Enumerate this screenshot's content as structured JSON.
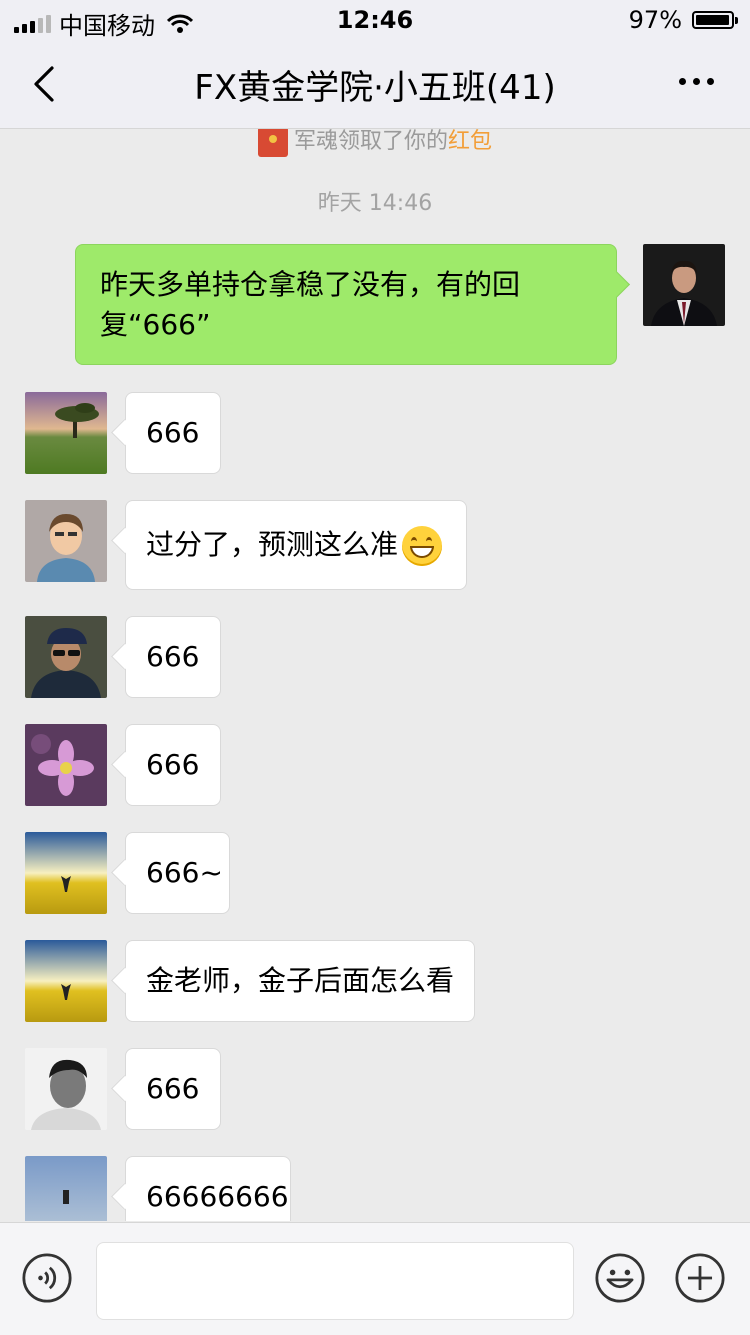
{
  "status_bar": {
    "carrier": "中国移动",
    "time": "12:46",
    "battery": "97%",
    "battery_level": 0.97
  },
  "header": {
    "title": "FX黄金学院·小五班(41)",
    "back_icon": "chevron-left-icon",
    "more_icon": "more-dots-icon"
  },
  "chat": {
    "system_note": {
      "prefix": "军魂领取了你的",
      "highlight": "红包",
      "highlight_color": "#f29e38"
    },
    "timestamp": "昨天 14:46",
    "messages": [
      {
        "side": "right",
        "text": "昨天多单持仓拿稳了没有，有的回复“666”"
      },
      {
        "side": "left",
        "text": "666"
      },
      {
        "side": "left",
        "text": "过分了，预测这么准",
        "emoji": "grinning-face-icon"
      },
      {
        "side": "left",
        "text": "666"
      },
      {
        "side": "left",
        "text": "666"
      },
      {
        "side": "left",
        "text": "666~"
      },
      {
        "side": "left",
        "text": "金老师，金子后面怎么看"
      },
      {
        "side": "left",
        "text": "666"
      },
      {
        "side": "left",
        "text": "66666666"
      }
    ]
  },
  "input_bar": {
    "voice_icon": "voice-icon",
    "emoji_icon": "emoji-icon",
    "plus_icon": "plus-icon",
    "value": ""
  },
  "colors": {
    "self_bubble": "#9eea6a",
    "other_bubble": "#ffffff",
    "chat_background": "#ebebeb"
  }
}
